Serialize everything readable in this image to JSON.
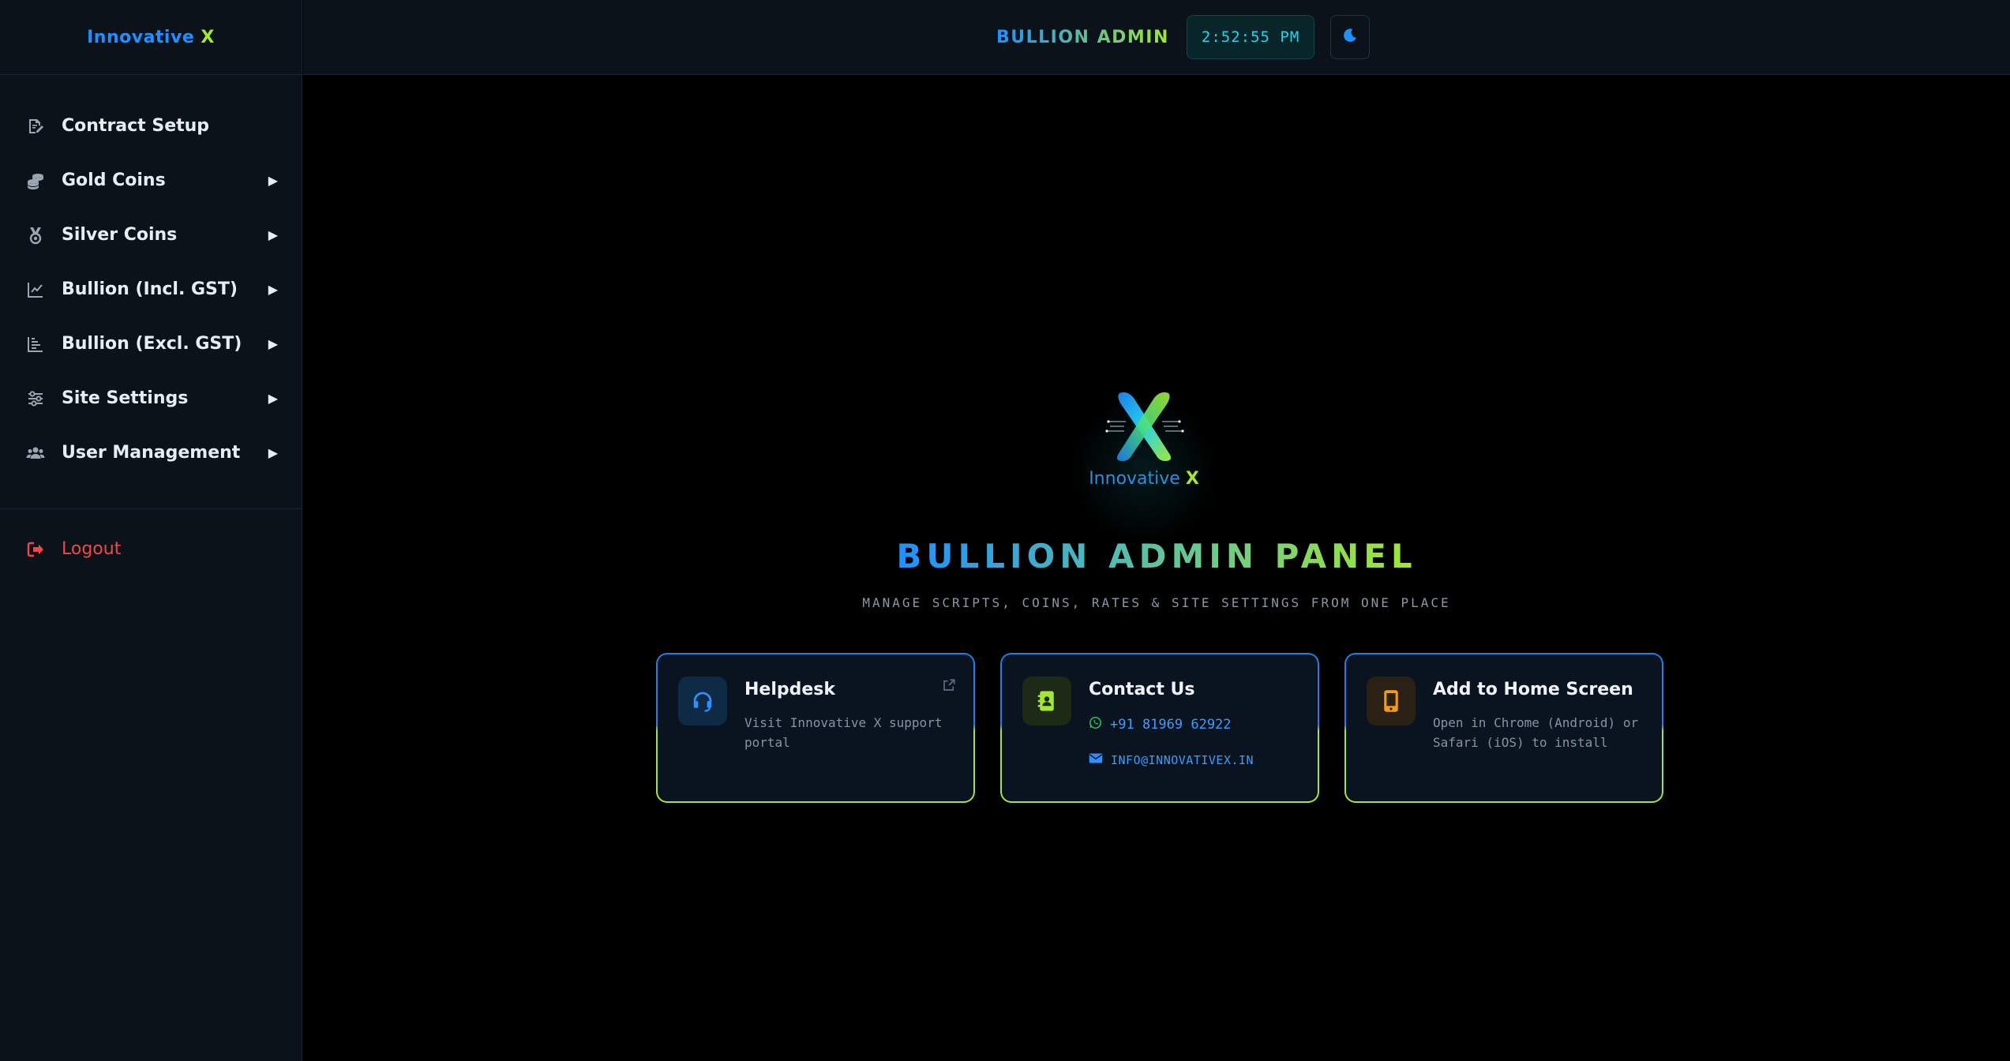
{
  "brand": {
    "name_a": "Innovative",
    "name_b": "X"
  },
  "sidebar": {
    "items": [
      {
        "label": "Contract Setup",
        "icon": "file-signature-icon",
        "has_submenu": false
      },
      {
        "label": "Gold Coins",
        "icon": "coins-icon",
        "has_submenu": true
      },
      {
        "label": "Silver Coins",
        "icon": "medal-icon",
        "has_submenu": true
      },
      {
        "label": "Bullion (Incl. GST)",
        "icon": "line-chart-icon",
        "has_submenu": true
      },
      {
        "label": "Bullion (Excl. GST)",
        "icon": "bar-chart-icon",
        "has_submenu": true
      },
      {
        "label": "Site Settings",
        "icon": "sliders-icon",
        "has_submenu": true
      },
      {
        "label": "User Management",
        "icon": "users-icon",
        "has_submenu": true
      }
    ],
    "submenu_arrow": "▶",
    "logout": {
      "label": "Logout",
      "icon": "logout-icon"
    }
  },
  "topbar": {
    "title": "BULLION ADMIN",
    "clock": "2:52:55 PM",
    "theme_toggle_icon": "moon-icon"
  },
  "hero": {
    "logo_text_a": "Innovative",
    "logo_text_b": "X",
    "title": "BULLION ADMIN PANEL",
    "subtitle": "MANAGE SCRIPTS, COINS, RATES & SITE SETTINGS FROM ONE PLACE"
  },
  "cards": {
    "helpdesk": {
      "title": "Helpdesk",
      "description": "Visit Innovative X support portal",
      "icon": "headset-icon"
    },
    "contact": {
      "title": "Contact Us",
      "phone": "+91 81969 62922",
      "email": "INFO@INNOVATIVEX.IN",
      "icon": "address-book-icon"
    },
    "a2hs": {
      "title": "Add to Home Screen",
      "description": "Open in Chrome (Android) or Safari (iOS) to install",
      "icon": "mobile-icon"
    }
  },
  "colors": {
    "accent_blue": "#1e90ff",
    "accent_green": "#a3e635",
    "logout_red": "#f04848",
    "clock_cyan": "#22d3ee",
    "mobile_orange": "#f59e0b"
  }
}
